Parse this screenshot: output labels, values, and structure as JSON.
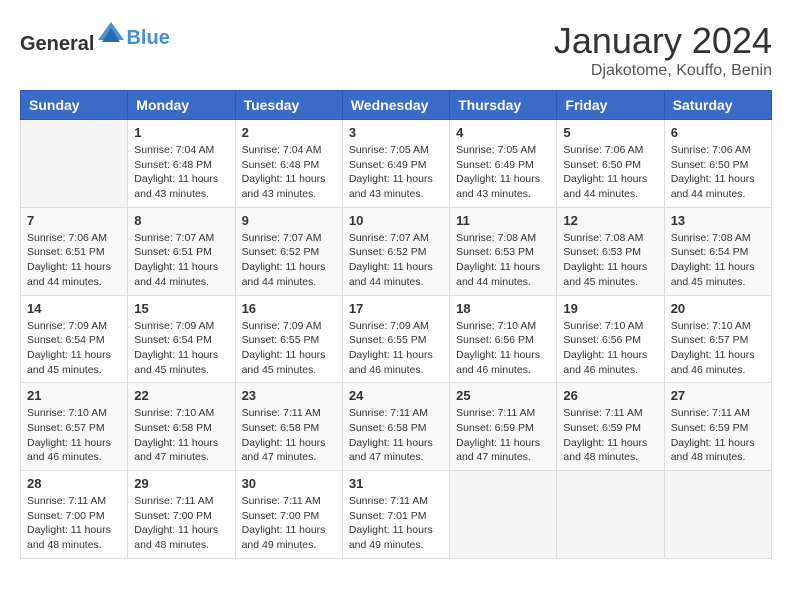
{
  "header": {
    "logo_general": "General",
    "logo_blue": "Blue",
    "month_year": "January 2024",
    "location": "Djakotome, Kouffo, Benin"
  },
  "days_of_week": [
    "Sunday",
    "Monday",
    "Tuesday",
    "Wednesday",
    "Thursday",
    "Friday",
    "Saturday"
  ],
  "weeks": [
    [
      {
        "day": "",
        "sunrise": "",
        "sunset": "",
        "daylight": ""
      },
      {
        "day": "1",
        "sunrise": "7:04 AM",
        "sunset": "6:48 PM",
        "daylight": "11 hours and 43 minutes."
      },
      {
        "day": "2",
        "sunrise": "7:04 AM",
        "sunset": "6:48 PM",
        "daylight": "11 hours and 43 minutes."
      },
      {
        "day": "3",
        "sunrise": "7:05 AM",
        "sunset": "6:49 PM",
        "daylight": "11 hours and 43 minutes."
      },
      {
        "day": "4",
        "sunrise": "7:05 AM",
        "sunset": "6:49 PM",
        "daylight": "11 hours and 43 minutes."
      },
      {
        "day": "5",
        "sunrise": "7:06 AM",
        "sunset": "6:50 PM",
        "daylight": "11 hours and 44 minutes."
      },
      {
        "day": "6",
        "sunrise": "7:06 AM",
        "sunset": "6:50 PM",
        "daylight": "11 hours and 44 minutes."
      }
    ],
    [
      {
        "day": "7",
        "sunrise": "7:06 AM",
        "sunset": "6:51 PM",
        "daylight": "11 hours and 44 minutes."
      },
      {
        "day": "8",
        "sunrise": "7:07 AM",
        "sunset": "6:51 PM",
        "daylight": "11 hours and 44 minutes."
      },
      {
        "day": "9",
        "sunrise": "7:07 AM",
        "sunset": "6:52 PM",
        "daylight": "11 hours and 44 minutes."
      },
      {
        "day": "10",
        "sunrise": "7:07 AM",
        "sunset": "6:52 PM",
        "daylight": "11 hours and 44 minutes."
      },
      {
        "day": "11",
        "sunrise": "7:08 AM",
        "sunset": "6:53 PM",
        "daylight": "11 hours and 44 minutes."
      },
      {
        "day": "12",
        "sunrise": "7:08 AM",
        "sunset": "6:53 PM",
        "daylight": "11 hours and 45 minutes."
      },
      {
        "day": "13",
        "sunrise": "7:08 AM",
        "sunset": "6:54 PM",
        "daylight": "11 hours and 45 minutes."
      }
    ],
    [
      {
        "day": "14",
        "sunrise": "7:09 AM",
        "sunset": "6:54 PM",
        "daylight": "11 hours and 45 minutes."
      },
      {
        "day": "15",
        "sunrise": "7:09 AM",
        "sunset": "6:54 PM",
        "daylight": "11 hours and 45 minutes."
      },
      {
        "day": "16",
        "sunrise": "7:09 AM",
        "sunset": "6:55 PM",
        "daylight": "11 hours and 45 minutes."
      },
      {
        "day": "17",
        "sunrise": "7:09 AM",
        "sunset": "6:55 PM",
        "daylight": "11 hours and 46 minutes."
      },
      {
        "day": "18",
        "sunrise": "7:10 AM",
        "sunset": "6:56 PM",
        "daylight": "11 hours and 46 minutes."
      },
      {
        "day": "19",
        "sunrise": "7:10 AM",
        "sunset": "6:56 PM",
        "daylight": "11 hours and 46 minutes."
      },
      {
        "day": "20",
        "sunrise": "7:10 AM",
        "sunset": "6:57 PM",
        "daylight": "11 hours and 46 minutes."
      }
    ],
    [
      {
        "day": "21",
        "sunrise": "7:10 AM",
        "sunset": "6:57 PM",
        "daylight": "11 hours and 46 minutes."
      },
      {
        "day": "22",
        "sunrise": "7:10 AM",
        "sunset": "6:58 PM",
        "daylight": "11 hours and 47 minutes."
      },
      {
        "day": "23",
        "sunrise": "7:11 AM",
        "sunset": "6:58 PM",
        "daylight": "11 hours and 47 minutes."
      },
      {
        "day": "24",
        "sunrise": "7:11 AM",
        "sunset": "6:58 PM",
        "daylight": "11 hours and 47 minutes."
      },
      {
        "day": "25",
        "sunrise": "7:11 AM",
        "sunset": "6:59 PM",
        "daylight": "11 hours and 47 minutes."
      },
      {
        "day": "26",
        "sunrise": "7:11 AM",
        "sunset": "6:59 PM",
        "daylight": "11 hours and 48 minutes."
      },
      {
        "day": "27",
        "sunrise": "7:11 AM",
        "sunset": "6:59 PM",
        "daylight": "11 hours and 48 minutes."
      }
    ],
    [
      {
        "day": "28",
        "sunrise": "7:11 AM",
        "sunset": "7:00 PM",
        "daylight": "11 hours and 48 minutes."
      },
      {
        "day": "29",
        "sunrise": "7:11 AM",
        "sunset": "7:00 PM",
        "daylight": "11 hours and 48 minutes."
      },
      {
        "day": "30",
        "sunrise": "7:11 AM",
        "sunset": "7:00 PM",
        "daylight": "11 hours and 49 minutes."
      },
      {
        "day": "31",
        "sunrise": "7:11 AM",
        "sunset": "7:01 PM",
        "daylight": "11 hours and 49 minutes."
      },
      {
        "day": "",
        "sunrise": "",
        "sunset": "",
        "daylight": ""
      },
      {
        "day": "",
        "sunrise": "",
        "sunset": "",
        "daylight": ""
      },
      {
        "day": "",
        "sunrise": "",
        "sunset": "",
        "daylight": ""
      }
    ]
  ],
  "labels": {
    "sunrise": "Sunrise:",
    "sunset": "Sunset:",
    "daylight": "Daylight:"
  }
}
